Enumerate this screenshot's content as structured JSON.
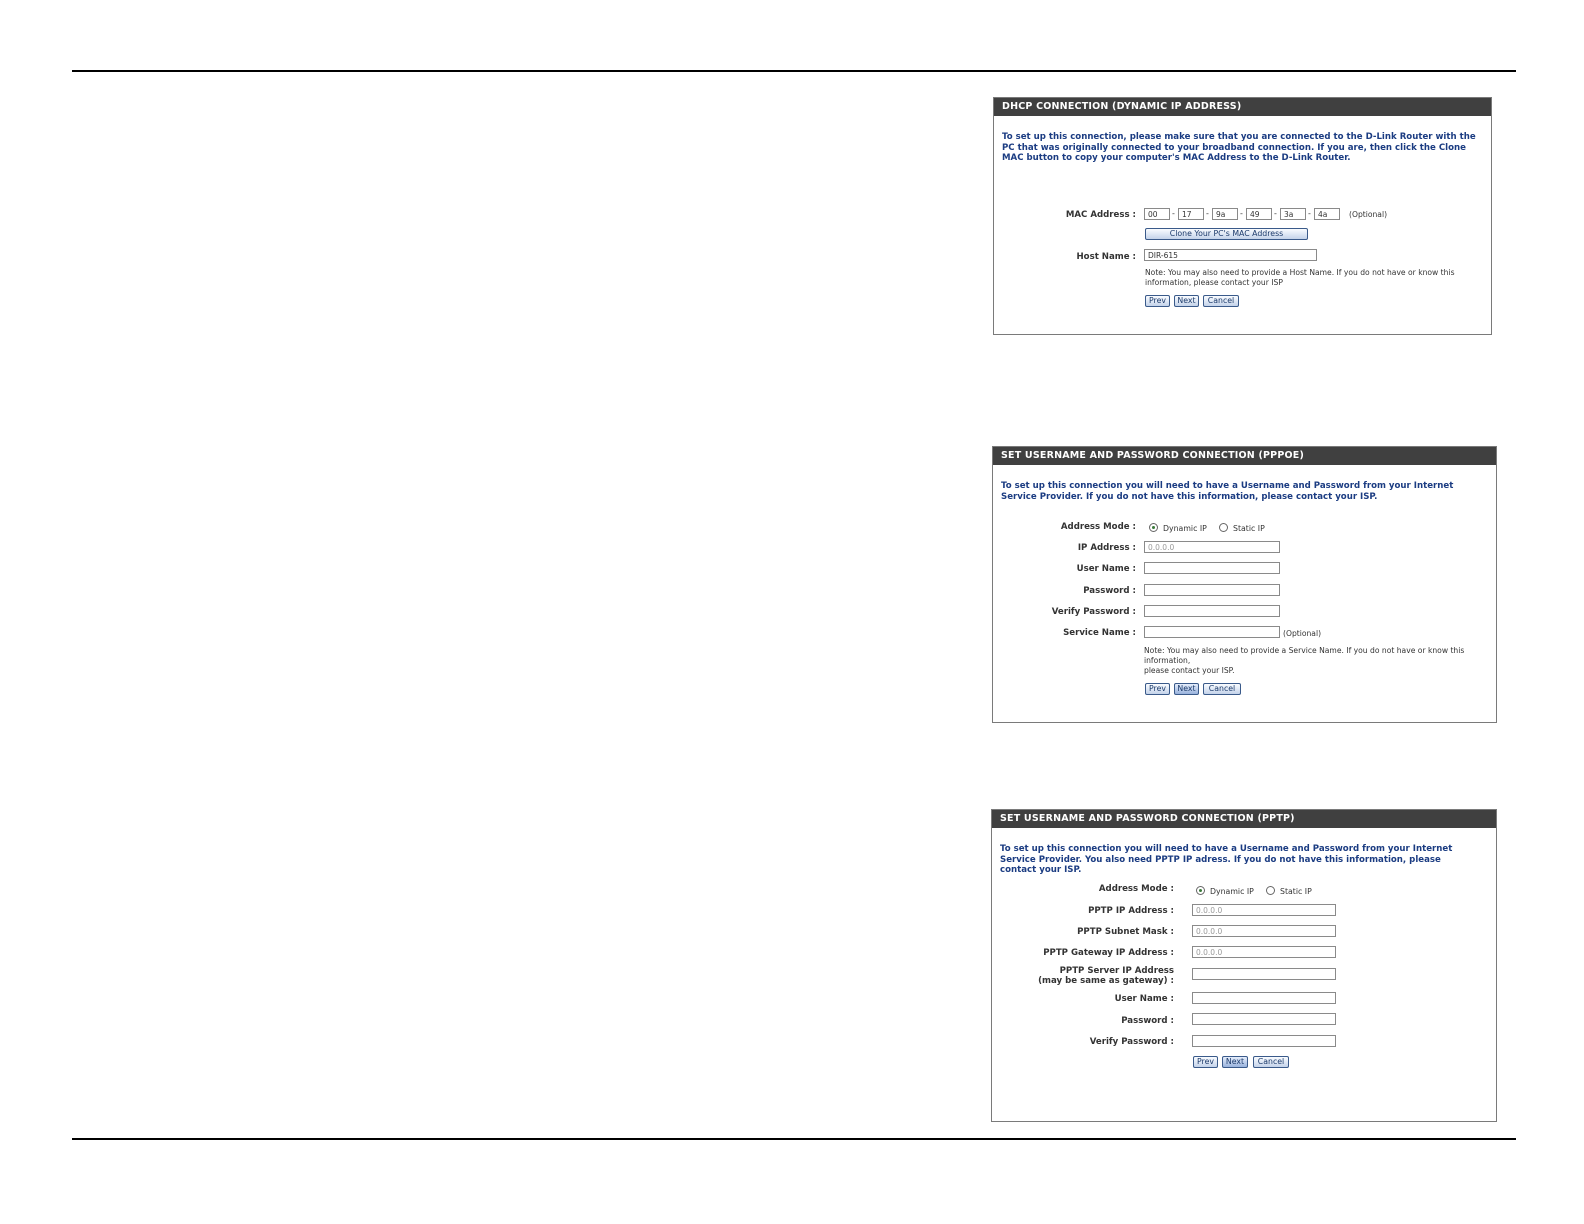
{
  "dhcp": {
    "title": "DHCP CONNECTION (DYNAMIC IP ADDRESS)",
    "intro": "To set up this connection, please make sure that you are connected to the D-Link Router with the PC that was originally connected to your broadband connection. If you are, then click the Clone MAC button to copy your computer's MAC Address to the D-Link Router.",
    "mac_label": "MAC Address :",
    "mac_octets": [
      "00",
      "17",
      "9a",
      "49",
      "3a",
      "4a"
    ],
    "mac_sep": "-",
    "optional": "(Optional)",
    "clone_button": "Clone Your PC's MAC Address",
    "host_label": "Host Name :",
    "host_value": "DIR-615",
    "note": "Note: You may also need to provide a Host Name. If you do not have or know this information, please contact your ISP",
    "buttons": {
      "prev": "Prev",
      "next": "Next",
      "cancel": "Cancel"
    }
  },
  "pppoe": {
    "title": "SET USERNAME AND PASSWORD CONNECTION (PPPOE)",
    "intro": "To set up this connection you will need to have a Username and Password from your Internet Service Provider. If you do not have this information, please contact your ISP.",
    "address_mode_label": "Address Mode :",
    "dynamic_ip": "Dynamic IP",
    "static_ip": "Static IP",
    "ip_label": "IP Address :",
    "ip_value": "0.0.0.0",
    "user_label": "User Name :",
    "password_label": "Password :",
    "verify_label": "Verify Password :",
    "service_label": "Service Name :",
    "optional": "(Optional)",
    "note_line1": "Note: You may also need to provide a Service Name. If you do not have or know this",
    "note_line2": "information,",
    "note_line3": "please contact your ISP.",
    "buttons": {
      "prev": "Prev",
      "next": "Next",
      "cancel": "Cancel"
    }
  },
  "pptp": {
    "title": "SET USERNAME AND PASSWORD CONNECTION (PPTP)",
    "intro": "To set up this connection you will need to have a Username and Password from your Internet Service Provider. You also need PPTP IP adress. If you do not have this information, please contact your ISP.",
    "address_mode_label": "Address Mode :",
    "dynamic_ip": "Dynamic IP",
    "static_ip": "Static IP",
    "ip_label": "PPTP IP Address :",
    "ip_value": "0.0.0.0",
    "mask_label": "PPTP Subnet Mask :",
    "mask_value": "0.0.0.0",
    "gateway_label": "PPTP Gateway IP Address :",
    "gateway_value": "0.0.0.0",
    "server_label_line1": "PPTP Server IP Address",
    "server_label_line2": "(may be same as gateway) :",
    "user_label": "User Name :",
    "password_label": "Password :",
    "verify_label": "Verify Password :",
    "buttons": {
      "prev": "Prev",
      "next": "Next",
      "cancel": "Cancel"
    }
  }
}
